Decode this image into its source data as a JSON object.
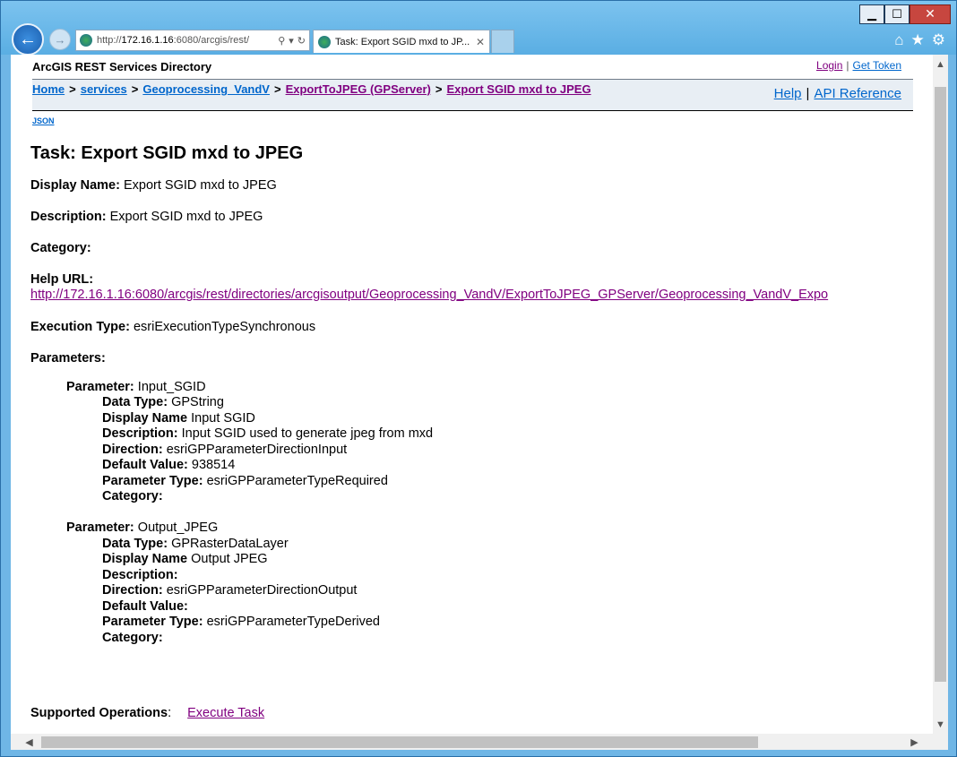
{
  "browser": {
    "address_url_prefix": "http://",
    "address_url_host": "172.16.1.16",
    "address_url_rest": ":6080/arcgis/rest/",
    "tab_title": "Task: Export SGID mxd to JP...",
    "win_min": "▁",
    "win_max": "☐",
    "win_close": "✕"
  },
  "header": {
    "title": "ArcGIS REST Services Directory",
    "login": "Login",
    "separator": "|",
    "get_token": "Get Token"
  },
  "breadcrumb": {
    "home": "Home",
    "services": "services",
    "folder": "Geoprocessing_VandV",
    "server": "ExportToJPEG (GPServer)",
    "task": "Export SGID mxd to JPEG",
    "gt": ">"
  },
  "help": {
    "help": "Help",
    "separator": "|",
    "api_reference": "API Reference"
  },
  "json_link": "JSON",
  "task": {
    "title": "Task: Export SGID mxd to JPEG",
    "display_name_label": "Display Name:",
    "display_name": "Export SGID mxd to JPEG",
    "description_label": "Description:",
    "description": "Export SGID mxd to JPEG",
    "category_label": "Category:",
    "category": "",
    "help_url_label": "Help URL:",
    "help_url": "http://172.16.1.16:6080/arcgis/rest/directories/arcgisoutput/Geoprocessing_VandV/ExportToJPEG_GPServer/Geoprocessing_VandV_Expo",
    "execution_type_label": "Execution Type:",
    "execution_type": "esriExecutionTypeSynchronous",
    "parameters_label": "Parameters:"
  },
  "parameters": [
    {
      "name_label": "Parameter:",
      "name": "Input_SGID",
      "data_type_label": "Data Type:",
      "data_type": "GPString",
      "display_name_label": "Display Name",
      "display_name": "Input SGID",
      "description_label": "Description:",
      "description": "Input SGID used to generate jpeg from mxd",
      "direction_label": "Direction:",
      "direction": "esriGPParameterDirectionInput",
      "default_value_label": "Default Value:",
      "default_value": "938514",
      "parameter_type_label": "Parameter Type:",
      "parameter_type": "esriGPParameterTypeRequired",
      "category_label": "Category:",
      "category": ""
    },
    {
      "name_label": "Parameter:",
      "name": "Output_JPEG",
      "data_type_label": "Data Type:",
      "data_type": "GPRasterDataLayer",
      "display_name_label": "Display Name",
      "display_name": "Output JPEG",
      "description_label": "Description:",
      "description": "",
      "direction_label": "Direction:",
      "direction": "esriGPParameterDirectionOutput",
      "default_value_label": "Default Value:",
      "default_value": "",
      "parameter_type_label": "Parameter Type:",
      "parameter_type": "esriGPParameterTypeDerived",
      "category_label": "Category:",
      "category": ""
    }
  ],
  "operations": {
    "label": "Supported Operations",
    "colon": ":",
    "execute_task": "Execute Task"
  },
  "icons": {
    "back": "back-arrow-icon",
    "forward": "forward-arrow-icon",
    "home": "home-icon",
    "favorites": "star-icon",
    "settings": "gear-icon"
  },
  "colors": {
    "link": "#0066cc",
    "visited": "#800080",
    "breadcrumb_bg": "#e8eef4",
    "window_frame": "#6fb6e6"
  }
}
